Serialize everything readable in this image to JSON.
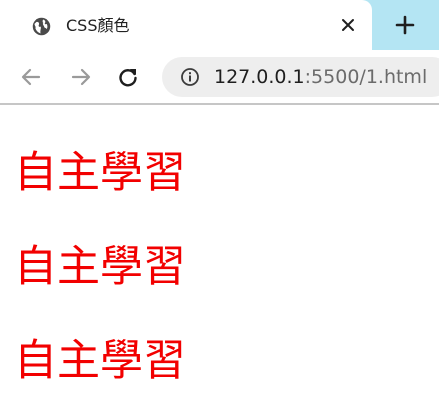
{
  "tab": {
    "title": "CSS顏色",
    "favicon": "globe-icon",
    "close_icon": "close-icon"
  },
  "new_tab_icon": "plus-icon",
  "toolbar": {
    "back_icon": "arrow-left-icon",
    "forward_icon": "arrow-right-icon",
    "reload_icon": "reload-icon",
    "site_info_icon": "info-icon",
    "url_host": "127.0.0.1",
    "url_path": ":5500/1.html"
  },
  "page": {
    "headings": [
      "自主學習",
      "自主學習",
      "自主學習"
    ]
  },
  "colors": {
    "tabstrip_background": "#b4e5f3",
    "heading_text": "#f20000",
    "omnibox_background": "#eeeeee"
  }
}
